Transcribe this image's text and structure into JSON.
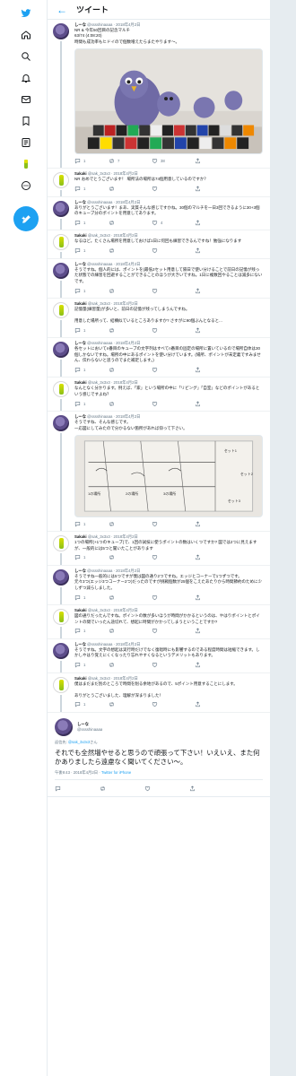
{
  "header": {
    "back": "←",
    "title": "ツイート"
  },
  "colors": {
    "accent": "#1da1f2"
  },
  "sidebar": {
    "icons": [
      "twitter-logo-icon",
      "home-icon",
      "search-icon",
      "bell-icon",
      "mail-icon",
      "bookmark-icon",
      "list-icon",
      "profile-icon",
      "more-icon",
      "compose-icon"
    ]
  },
  "root": {
    "name": "しーな",
    "handle": "@sssshinaaaa · 2018年4月2日",
    "body": [
      "NR & 今年50回目の記念マルチ",
      "63/74 (4:08:20)",
      "時間も成功率もヒドイので個数増えたらまたやります〜。"
    ],
    "actions": {
      "reply": "1",
      "retweet": "7",
      "like": "38"
    }
  },
  "tweets": [
    {
      "id": "t1",
      "kind": "b",
      "name": "Sakaki",
      "handle": "@sak_3x3x3 · 2018年4月2日",
      "body": [
        "NR おめでとうございます！ 場所法の場所は74個用意しているのですか？"
      ],
      "actions": {
        "reply": "1",
        "retweet": "",
        "like": ""
      }
    },
    {
      "id": "t2",
      "kind": "a",
      "name": "しーな",
      "handle": "@sssshinaaaa · 2018年4月2日",
      "body": [
        "ありがとうございます！まあ、実質そんな感じですかね。30個のマルチを一日3回できるように30+3個のキューブ分のポイントを用意してあります。"
      ],
      "actions": {
        "reply": "1",
        "retweet": "",
        "like": "4"
      }
    },
    {
      "id": "t3",
      "kind": "b",
      "name": "Sakaki",
      "handle": "@sak_3x3x3 · 2018年4月2日",
      "body": [
        "なるほど。たくさん場所を用意しておけば1日に何回も練習できるんですね！勉強になります"
      ],
      "actions": {
        "reply": "1",
        "retweet": "",
        "like": ""
      }
    },
    {
      "id": "t4",
      "kind": "a",
      "name": "しーな",
      "handle": "@sssshinaaaa · 2018年4月2日",
      "body": [
        "そうですね。個人的には、ポイントを(最低2セット用意して隔日で使い分けることで前日の記憶が残った状態での練習を回避することができることのほうが大きいですね。1日に複数回やることは滅多にないです。"
      ],
      "actions": {
        "reply": "1",
        "retweet": "",
        "like": ""
      }
    },
    {
      "id": "t5",
      "kind": "b",
      "name": "Sakaki",
      "handle": "@sak_3x3x3 · 2018年4月2日",
      "body": [
        "記憶量(練習量)が多いと、前日の記憶が残ってしまうんですね。",
        "",
        "用意した場所って、結構似ているところありますか? さすがに90個ぶんとなると..."
      ],
      "actions": {
        "reply": "1",
        "retweet": "",
        "like": ""
      }
    },
    {
      "id": "t6",
      "kind": "a",
      "name": "しーな",
      "handle": "@sssshinaaaa · 2018年4月2日",
      "body": [
        "各セットにおいてn番目のキューブの文字列はすべてn番目の固定の場所に置いているので場所自体は30個しかないですね。場所の中にあるポイントを使い分けています。(場所、ポイントが未定義ですみません、伝わらないと思うのでまた補足します。)"
      ],
      "actions": {
        "reply": "1",
        "retweet": "",
        "like": ""
      }
    },
    {
      "id": "t7",
      "kind": "b",
      "name": "Sakaki",
      "handle": "@sak_3x3x3 · 2018年4月2日",
      "body": [
        "なんとなく分かります。例えば、「家」という場所の中に「リビング」「自室」などのポイントがあるという感じですよね？"
      ],
      "actions": {
        "reply": "1",
        "retweet": "",
        "like": ""
      }
    },
    {
      "id": "t8",
      "kind": "a",
      "name": "しーな",
      "handle": "@sssshinaaaa · 2018年4月2日",
      "body": [
        "そうですね、そんな感じです。",
        "一応図にしてみたので分かるない箇所があれば仰って下さい。"
      ],
      "actions": {
        "reply": "1",
        "retweet": "",
        "like": ""
      },
      "note": {
        "left": "セット1",
        "right": "セット2",
        "mid": "セット3",
        "c1": "1の場所",
        "c2": "2の場所",
        "c3": "3の場所"
      }
    },
    {
      "id": "t9",
      "kind": "b",
      "name": "Sakaki",
      "handle": "@sak_3x3x3 · 2018年4月2日",
      "body": [
        "1つの場所(+1つのキューブ)で、1回の試技に使うポイントの数はいくつですか? 図では2つに見えますが、一般的には5つと聞いたことがあります"
      ],
      "actions": {
        "reply": "1",
        "retweet": "",
        "like": ""
      }
    },
    {
      "id": "t10",
      "kind": "a",
      "name": "しーな",
      "handle": "@sssshinaaaa · 2018年4月2日",
      "body": [
        "そうですね一般的には5つですが僕は図の通り2つですね。エッジとコーナーで1つずつです。",
        "元々3つ(エッジ3つコーナー2つ)だったのですが挑戦個数が25個をこえたあたりから時間節約のために少しずつ減らしました。"
      ],
      "actions": {
        "reply": "1",
        "retweet": "",
        "like": ""
      }
    },
    {
      "id": "t11",
      "kind": "b",
      "name": "Sakaki",
      "handle": "@sak_3x3x3 · 2018年4月2日",
      "body": [
        "図の通りだったんですね。ポイントの数が多いほうが時間がかかるというのは、やはりポイントとポイントの間でいったん途切れて、想起に時間がかかってしまうということですか?"
      ],
      "actions": {
        "reply": "1",
        "retweet": "",
        "like": ""
      }
    },
    {
      "id": "t12",
      "kind": "a",
      "name": "しーな",
      "handle": "@sssshinaaaa · 2018年4月2日",
      "body": [
        "そうですね。文字の想起は実行時だけでなく復唱時にも影響するのである程度時間は短縮できます。しかしやはり覚えにくくなったり忘れやすくなるというデメリットもあります。"
      ],
      "actions": {
        "reply": "1",
        "retweet": "",
        "like": ""
      }
    },
    {
      "id": "t13",
      "kind": "b",
      "name": "Sakaki",
      "handle": "@sak_3x3x3 · 2018年4月2日",
      "body": [
        "僕はまだまだ別のところで時間を削る余地があるので、5ポイント用意することにします。",
        "",
        "ありがとうございました、理解が深まりました！"
      ],
      "actions": {
        "reply": "1",
        "retweet": "",
        "like": ""
      }
    }
  ],
  "final": {
    "name": "しーな",
    "handle": "@sssshinaaaa",
    "reply_prefix": "返信先: ",
    "reply_to": "@sak_3x3x3",
    "reply_suffix": "さん",
    "text": "それでも全然増やせると思うので頑張って下さい！いえいえ、また何かありましたら遠慮なく聞いてください〜。",
    "time": "午後9:43 · 2018年4月2日 · ",
    "client": "Twitter for iPhone"
  }
}
